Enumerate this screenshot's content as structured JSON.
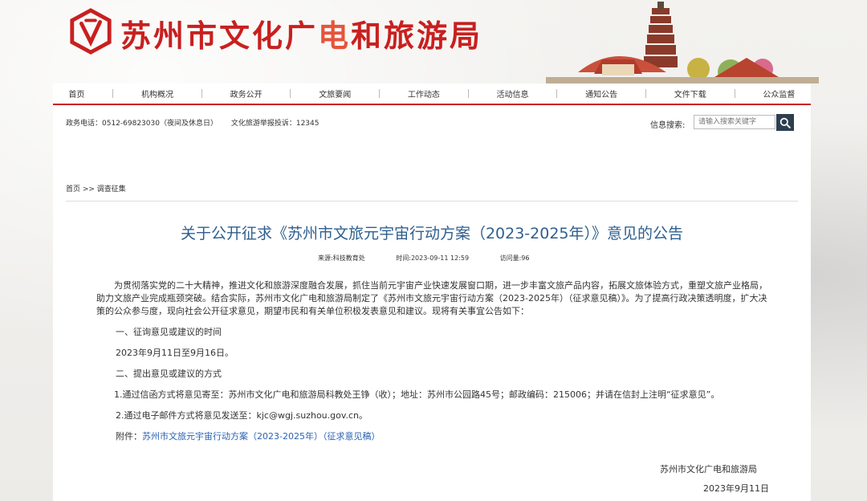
{
  "header": {
    "site_title_part1": "苏州市文化广",
    "site_title_part2": "电",
    "site_title_part3": "和旅游局"
  },
  "nav": {
    "items": [
      {
        "label": "首页"
      },
      {
        "label": "机构概况"
      },
      {
        "label": "政务公开"
      },
      {
        "label": "文旅要闻"
      },
      {
        "label": "工作动态"
      },
      {
        "label": "活动信息"
      },
      {
        "label": "通知公告"
      },
      {
        "label": "文件下载"
      },
      {
        "label": "公众监督"
      }
    ]
  },
  "info_bar": {
    "phone": "政务电话：0512-69823030（夜间及休息日）",
    "report": "文化旅游举报投诉：12345"
  },
  "search": {
    "label": "信息搜索:",
    "placeholder": "请输入搜索关键字"
  },
  "breadcrumb": "首页 >> 调查征集",
  "article": {
    "title": "关于公开征求《苏州市文旅元宇宙行动方案（2023-2025年）》意见的公告",
    "source": "来源:科技教育处",
    "time": "时间:2023-09-11 12:59",
    "views": "访问量:96",
    "para1": "为贯彻落实党的二十大精神，推进文化和旅游深度融合发展，抓住当前元宇宙产业快速发展窗口期，进一步丰富文旅产品内容，拓展文旅体验方式，重塑文旅产业格局，助力文旅产业完成瓶颈突破。结合实际，苏州市文化广电和旅游局制定了《苏州市文旅元宇宙行动方案（2023-2025年）（征求意见稿）》。为了提高行政决策透明度，扩大决策的公众参与度，现向社会公开征求意见，期望市民和有关单位积极发表意见和建议。现将有关事宜公告如下：",
    "section1": "一、征询意见或建议的时间",
    "dates": "2023年9月11日至9月16日。",
    "section2": "二、提出意见或建议的方式",
    "method1": "1.通过信函方式将意见寄至：苏州市文化广电和旅游局科教处王铮（收）；地址：苏州市公园路45号；邮政编码：215006；并请在信封上注明“征求意见”。",
    "method2": "2.通过电子邮件方式将意见发送至：kjc@wgj.suzhou.gov.cn。",
    "attach_label": "附件：",
    "attach_link": "苏州市文旅元宇宙行动方案（2023-2025年）（征求意见稿）",
    "sign_org": "苏州市文化广电和旅游局",
    "sign_date": "2023年9月11日"
  },
  "colors": {
    "brand_red": "#c8201f",
    "title_blue": "#2f5f8f",
    "link_blue": "#2a62b1",
    "search_button": "#2d3e50"
  }
}
